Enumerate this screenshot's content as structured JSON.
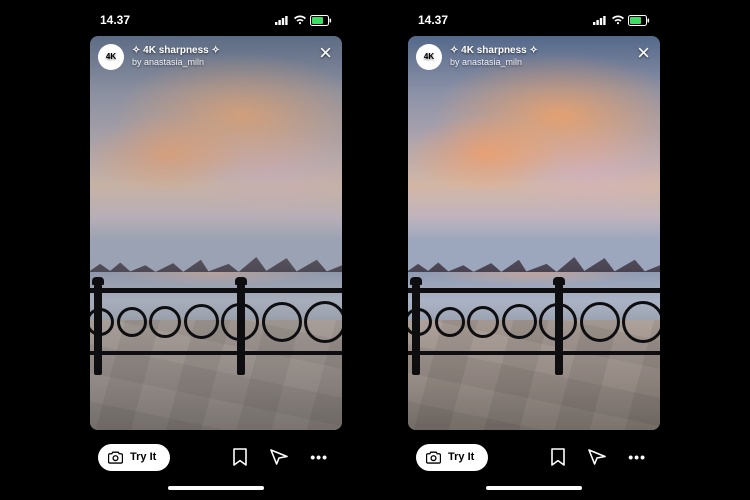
{
  "status": {
    "time": "14.37"
  },
  "story": {
    "avatar_label": "4K",
    "title": "✧ 4K sharpness ✧",
    "author_prefix": "by ",
    "author": "anastasia_miln"
  },
  "actions": {
    "try_label": "Try It",
    "more_label": "•••"
  }
}
